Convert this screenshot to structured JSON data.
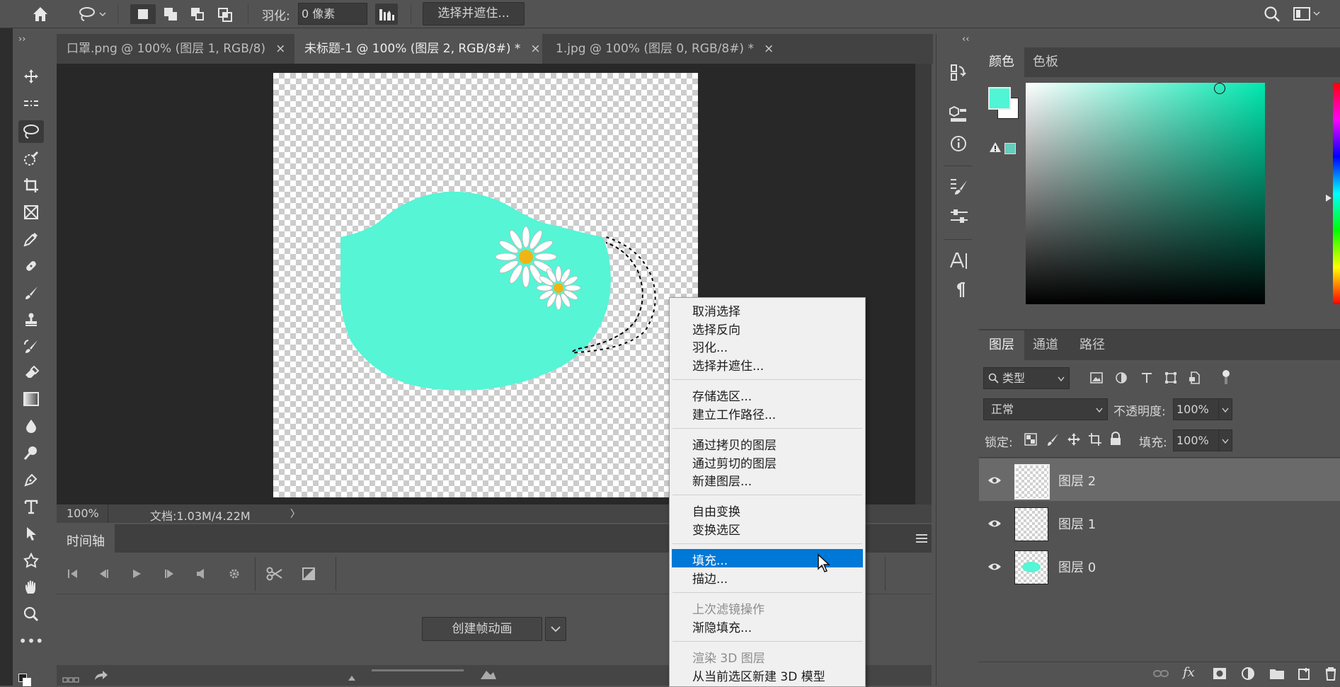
{
  "options_bar": {
    "feather_label": "羽化:",
    "feather_value": "0 像素",
    "select_mask_button": "选择并遮住..."
  },
  "tabs": [
    {
      "label": "口罩.png @ 100% (图层 1, RGB/8)",
      "close": "×"
    },
    {
      "label": "未标题-1 @ 100% (图层 2, RGB/8#) *",
      "close": "×"
    },
    {
      "label": "1.jpg @ 100% (图层 0, RGB/8#) *",
      "close": "×"
    }
  ],
  "status": {
    "zoom": "100%",
    "doc": "文档:1.03M/4.22M",
    "arrow": "〉"
  },
  "timeline": {
    "title": "时间轴",
    "create_button": "创建帧动画"
  },
  "context_menu": {
    "items": [
      "取消选择",
      "选择反向",
      "羽化...",
      "选择并遮住...",
      "存储选区...",
      "建立工作路径...",
      "通过拷贝的图层",
      "通过剪切的图层",
      "新建图层...",
      "自由变换",
      "变换选区",
      "填充...",
      "描边...",
      "上次滤镜操作",
      "渐隐填充...",
      "渲染 3D 图层",
      "从当前选区新建 3D 模型"
    ]
  },
  "color_panel": {
    "tabs": [
      "颜色",
      "色板"
    ],
    "foreground_color": "#4ff5d4",
    "background_color": "#ffffff",
    "hue_color": "#00e8b0"
  },
  "layers_panel": {
    "tabs": [
      "图层",
      "通道",
      "路径"
    ],
    "filter_kind": "类型",
    "blend_mode": "正常",
    "opacity_label": "不透明度:",
    "opacity_value": "100%",
    "lock_label": "锁定:",
    "fill_label": "填充:",
    "fill_value": "100%",
    "layers": [
      {
        "name": "图层 2",
        "selected": true
      },
      {
        "name": "图层 1",
        "selected": false
      },
      {
        "name": "图层 0",
        "selected": false
      }
    ]
  },
  "colors": {
    "mask_fill": "#55f5d6",
    "menu_highlight": "#0078d7"
  }
}
